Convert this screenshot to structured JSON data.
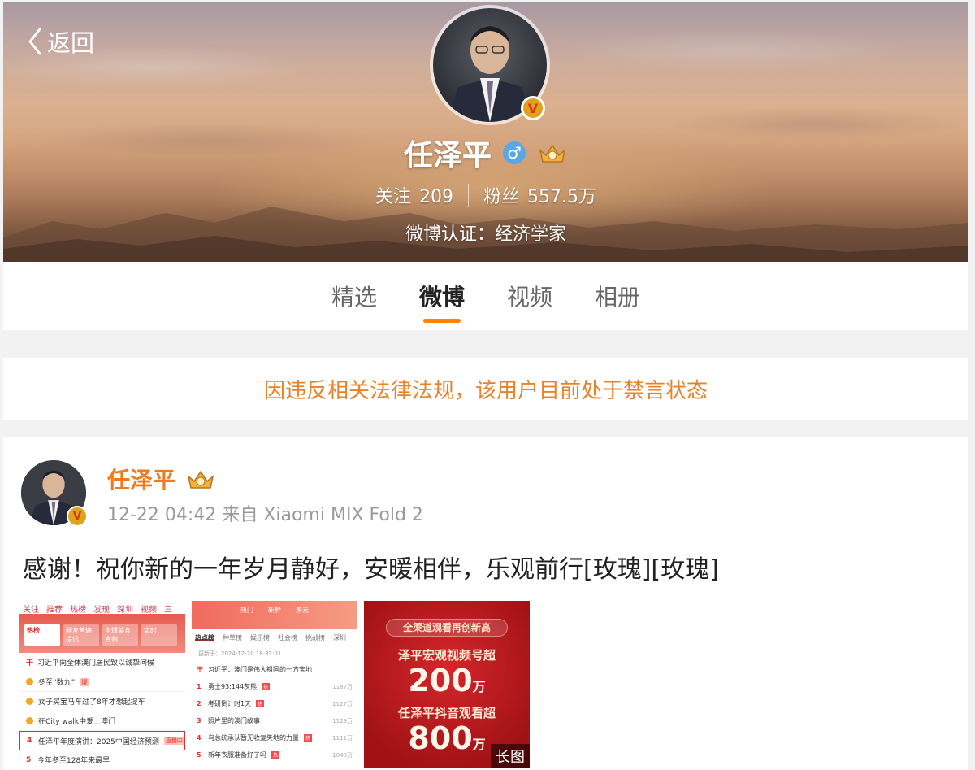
{
  "header": {
    "back_label": "返回",
    "name": "任泽平",
    "gender_symbol": "♂",
    "following_label": "关注",
    "following_count": "209",
    "followers_label": "粉丝",
    "followers_count": "557.5万",
    "verification": "微博认证：经济学家",
    "badge_letter": "V"
  },
  "tabs": [
    {
      "label": "精选",
      "active": false
    },
    {
      "label": "微博",
      "active": true
    },
    {
      "label": "视频",
      "active": false
    },
    {
      "label": "相册",
      "active": false
    }
  ],
  "notice": "因违反相关法律法规，该用户目前处于禁言状态",
  "post": {
    "author": "任泽平",
    "meta": "12-22 04:42 来自 Xiaomi MIX Fold 2",
    "text": "感谢！祝你新的一年岁月静好，安暖相伴，乐观前行[玫瑰][玫瑰]",
    "badge_letter": "V",
    "thumb1": {
      "topnav": [
        "关注",
        "推荐",
        "热榜",
        "发现",
        "深圳",
        "视频",
        "三"
      ],
      "chips": [
        "热榜",
        "网友普遍提讯",
        "全球美食宣判",
        "实时"
      ],
      "rows": [
        {
          "rank": "干",
          "text": "习近平向全体澳门居民致以诚挚问候",
          "tag": ""
        },
        {
          "rank": "",
          "text": "冬至“数九”",
          "tag": "爆"
        },
        {
          "rank": "",
          "text": "女子买宝马车过了8年才想起提车",
          "tag": ""
        },
        {
          "rank": "",
          "text": "在City walk中爱上澳门",
          "tag": ""
        },
        {
          "rank": "4",
          "text": "任泽平年度演讲：2025中国经济预测",
          "tag": "直播中"
        },
        {
          "rank": "5",
          "text": "今年冬至128年来最早",
          "tag": ""
        }
      ]
    },
    "thumb2": {
      "header_tabs": [
        "热门",
        "新鲜",
        "多元"
      ],
      "subtabs": [
        "热点榜",
        "种草榜",
        "娱乐榜",
        "社会榜",
        "挑战榜",
        "深圳"
      ],
      "updated": "更新于：2024-12-20 18:32:01",
      "rows": [
        {
          "rank": "干",
          "text": "习近平：澳门是伟大祖国的一方宝地",
          "hot": "",
          "count": ""
        },
        {
          "rank": "1",
          "text": "勇士93:144灰熊",
          "hot": "热",
          "count": "1187万"
        },
        {
          "rank": "2",
          "text": "考研倒计时1天",
          "hot": "热",
          "count": "1127万"
        },
        {
          "rank": "3",
          "text": "照片里的澳门故事",
          "hot": "",
          "count": "1129万"
        },
        {
          "rank": "4",
          "text": "乌总统承认暂无收复失地的力量",
          "hot": "热",
          "count": "1111万"
        },
        {
          "rank": "5",
          "text": "新年衣服准备好了吗",
          "hot": "热",
          "count": "1048万"
        }
      ]
    },
    "thumb3": {
      "pill": "全渠道观看再创新高",
      "line1": "泽平宏观视频号超",
      "num1": "200",
      "unit1": "万",
      "line2": "任泽平抖音观看超",
      "num2": "800",
      "unit2": "万",
      "long_image_tag": "长图"
    }
  },
  "colors": {
    "accent": "#ff8200",
    "notice_text": "#e8822a",
    "author_name": "#f07a20"
  }
}
